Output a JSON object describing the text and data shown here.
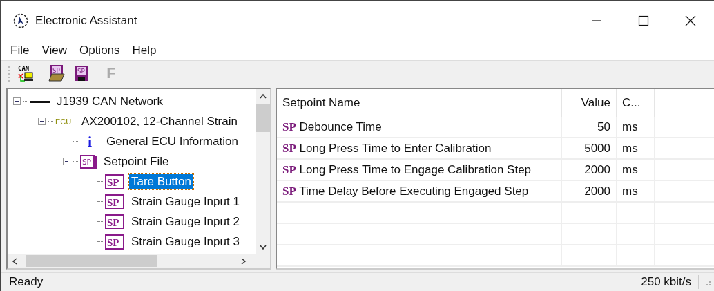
{
  "window": {
    "title": "Electronic Assistant"
  },
  "menu": [
    "File",
    "View",
    "Options",
    "Help"
  ],
  "toolbar": [
    {
      "kind": "can",
      "text": "CAN",
      "disabled": false
    },
    {
      "kind": "sp-open",
      "text": "SP",
      "disabled": false
    },
    {
      "kind": "sp-save",
      "text": "SP",
      "disabled": false
    },
    {
      "kind": "letter",
      "text": "F",
      "disabled": true
    }
  ],
  "tree": [
    {
      "label": "J1939 CAN Network",
      "icon": {
        "kind": "line"
      },
      "expanded": true,
      "selected": false,
      "children": [
        {
          "label": "AX200102, 12-Channel Strain",
          "icon": {
            "kind": "ecu",
            "text": "ECU"
          },
          "expanded": true,
          "selected": false,
          "children": [
            {
              "label": "General ECU Information",
              "icon": {
                "kind": "info",
                "text": "i"
              },
              "selected": false
            },
            {
              "label": "Setpoint File",
              "icon": {
                "kind": "spfile",
                "text": "SP"
              },
              "expanded": true,
              "selected": false,
              "children": [
                {
                  "label": "Tare Button",
                  "icon": {
                    "kind": "sp",
                    "text": "SP"
                  },
                  "selected": true
                },
                {
                  "label": "Strain Gauge Input 1",
                  "icon": {
                    "kind": "sp",
                    "text": "SP"
                  },
                  "selected": false
                },
                {
                  "label": "Strain Gauge Input 2",
                  "icon": {
                    "kind": "sp",
                    "text": "SP"
                  },
                  "selected": false
                },
                {
                  "label": "Strain Gauge Input 3",
                  "icon": {
                    "kind": "sp",
                    "text": "SP"
                  },
                  "selected": false
                }
              ]
            }
          ]
        }
      ]
    }
  ],
  "table": {
    "columns": [
      "Setpoint Name",
      "Value",
      "C..."
    ],
    "rows": [
      {
        "icon_text": "SP",
        "name": "Debounce Time",
        "value": "50",
        "unit": "ms"
      },
      {
        "icon_text": "SP",
        "name": "Long Press Time to Enter Calibration",
        "value": "5000",
        "unit": "ms"
      },
      {
        "icon_text": "SP",
        "name": "Long Press Time to Engage Calibration Step",
        "value": "2000",
        "unit": "ms"
      },
      {
        "icon_text": "SP",
        "name": "Time Delay Before Executing Engaged Step",
        "value": "2000",
        "unit": "ms"
      }
    ]
  },
  "status_bar": {
    "message": "Ready",
    "baud": "250 kbit/s"
  }
}
